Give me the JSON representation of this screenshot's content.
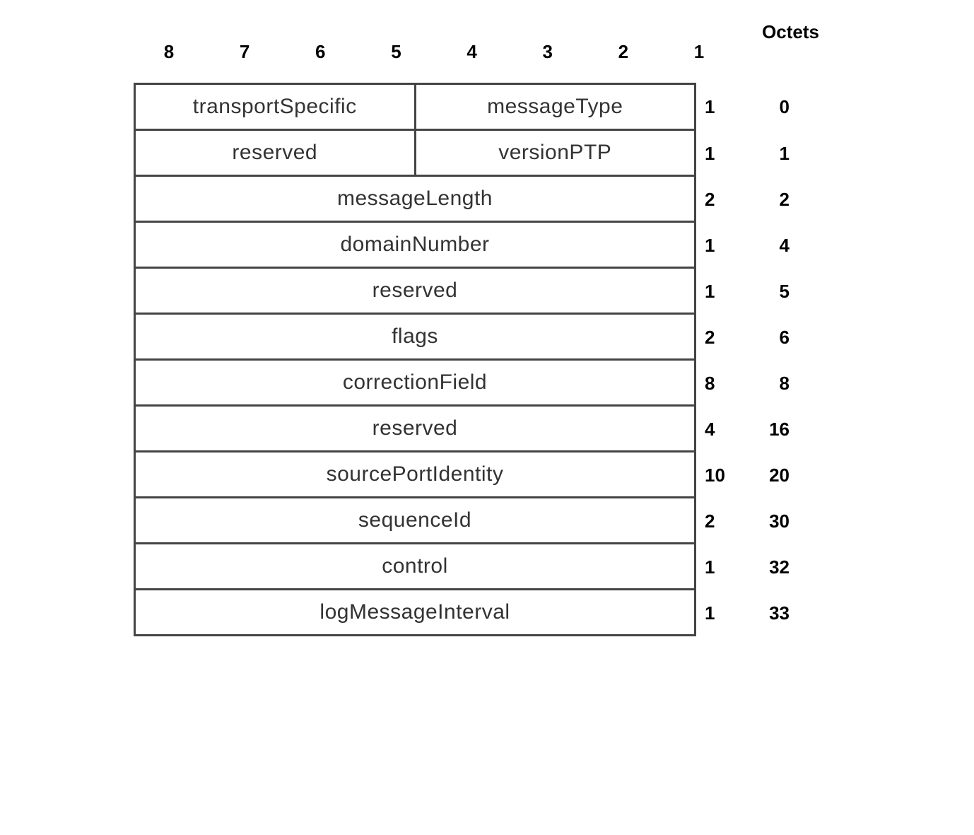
{
  "title": "Octets",
  "bit_numbers": [
    "8",
    "7",
    "6",
    "5",
    "4",
    "3",
    "2",
    "1"
  ],
  "rows": [
    {
      "fields": [
        "transportSpecific",
        "messageType"
      ],
      "length": "1",
      "offset": "0"
    },
    {
      "fields": [
        "reserved",
        "versionPTP"
      ],
      "length": "1",
      "offset": "1"
    },
    {
      "fields": [
        "messageLength"
      ],
      "length": "2",
      "offset": "2"
    },
    {
      "fields": [
        "domainNumber"
      ],
      "length": "1",
      "offset": "4"
    },
    {
      "fields": [
        "reserved"
      ],
      "length": "1",
      "offset": "5"
    },
    {
      "fields": [
        "flags"
      ],
      "length": "2",
      "offset": "6"
    },
    {
      "fields": [
        "correctionField"
      ],
      "length": "8",
      "offset": "8"
    },
    {
      "fields": [
        "reserved"
      ],
      "length": "4",
      "offset": "16"
    },
    {
      "fields": [
        "sourcePortIdentity"
      ],
      "length": "10",
      "offset": "20"
    },
    {
      "fields": [
        "sequenceId"
      ],
      "length": "2",
      "offset": "30"
    },
    {
      "fields": [
        "control"
      ],
      "length": "1",
      "offset": "32"
    },
    {
      "fields": [
        "logMessageInterval"
      ],
      "length": "1",
      "offset": "33"
    }
  ]
}
